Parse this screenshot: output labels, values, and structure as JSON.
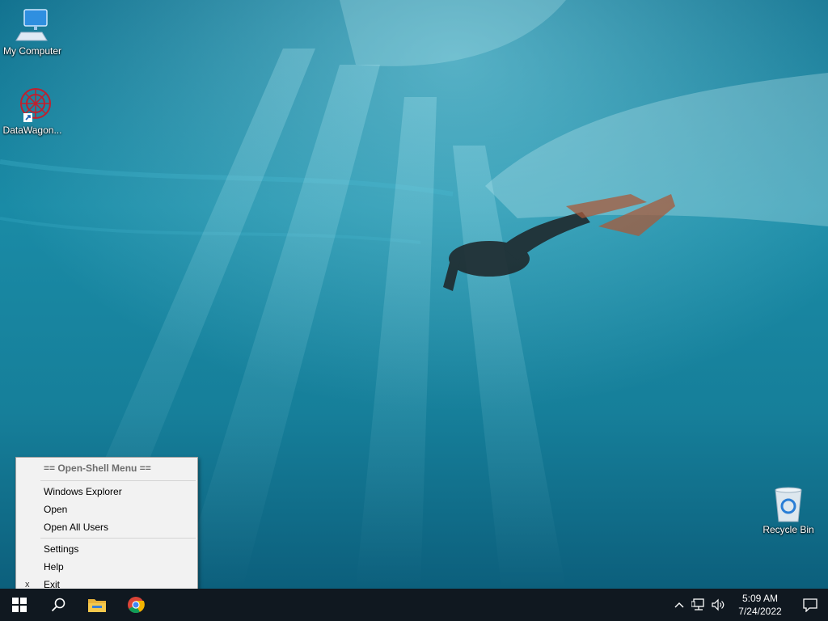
{
  "desktop": {
    "icons": [
      {
        "name": "my-computer",
        "label": "My Computer"
      },
      {
        "name": "datawagon",
        "label": "DataWagon..."
      },
      {
        "name": "recycle-bin",
        "label": "Recycle Bin"
      }
    ]
  },
  "context_menu": {
    "header": "== Open-Shell Menu ==",
    "items": [
      {
        "label": "Windows Explorer"
      },
      {
        "label": "Open"
      },
      {
        "label": "Open All Users"
      },
      {
        "label": "Settings"
      },
      {
        "label": "Help"
      },
      {
        "label": "Exit",
        "mark": "x"
      }
    ]
  },
  "taskbar": {
    "pinned": [
      "start-icon",
      "search-icon",
      "file-explorer-icon",
      "chrome-icon"
    ],
    "tray": [
      "chevron-up-icon",
      "network-icon",
      "volume-icon"
    ],
    "clock": {
      "time": "5:09 AM",
      "date": "7/24/2022"
    },
    "notification": "action-center-icon"
  },
  "colors": {
    "taskbar": "#101820",
    "menu_bg": "#f2f2f2",
    "wallpaper_deep": "#0b5f7a",
    "wallpaper_light": "#27a7c0"
  }
}
